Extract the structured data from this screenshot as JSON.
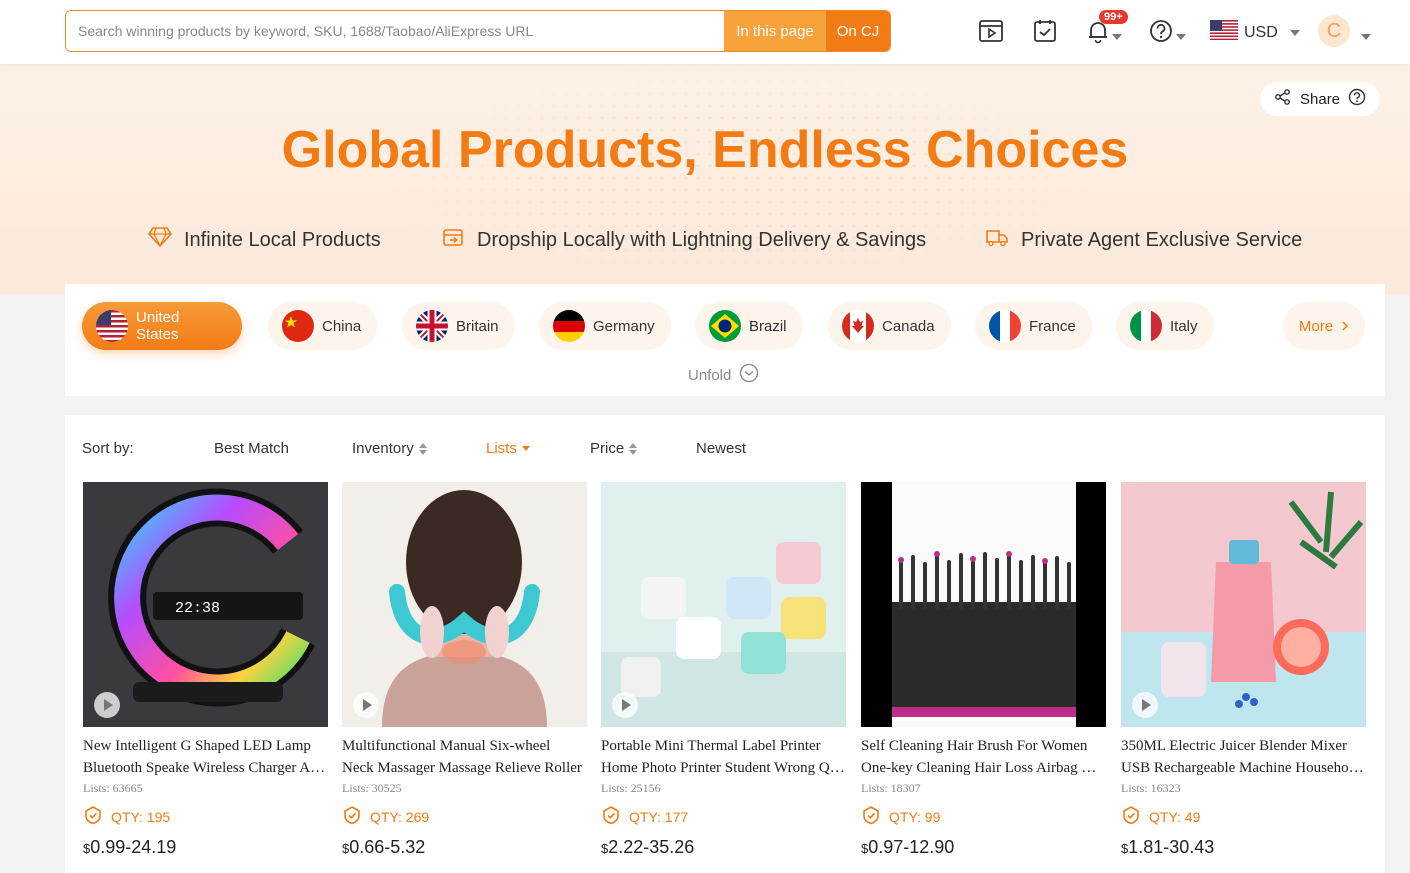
{
  "header": {
    "search_placeholder": "Search winning products by keyword, SKU, 1688/Taobao/AliExpress URL",
    "btn_this_page": "In this page",
    "btn_on_cj": "On CJ",
    "notification_badge": "99+",
    "currency": "USD",
    "avatar_letter": "C"
  },
  "hero": {
    "share_label": "Share",
    "title": "Global Products, Endless Choices",
    "features": [
      "Infinite Local Products",
      "Dropship Locally with Lightning Delivery & Savings",
      "Private Agent Exclusive Service"
    ]
  },
  "countries": {
    "items": [
      "United States",
      "China",
      "Britain",
      "Germany",
      "Brazil",
      "Canada",
      "France",
      "Italy"
    ],
    "more_label": "More",
    "unfold_label": "Unfold"
  },
  "sort": {
    "label": "Sort by:",
    "options": [
      "Best Match",
      "Inventory",
      "Lists",
      "Price",
      "Newest"
    ],
    "active": "Lists"
  },
  "products": [
    {
      "title1": "New Intelligent G Shaped LED Lamp",
      "title2": "Bluetooth Speake Wireless Charger Atmosphere Lamp",
      "lists": "Lists: 63665",
      "qty": "QTY: 195",
      "currency_symbol": "$",
      "price": "0.99-24.19"
    },
    {
      "title1": "Multifunctional Manual Six-wheel",
      "title2": "Neck Massager Massage Relieve Roller",
      "lists": "Lists: 30525",
      "qty": "QTY: 269",
      "currency_symbol": "$",
      "price": "0.66-5.32"
    },
    {
      "title1": "Portable Mini Thermal Label Printer",
      "title2": "Home Photo Printer Student Wrong Question",
      "lists": "Lists: 25156",
      "qty": "QTY: 177",
      "currency_symbol": "$",
      "price": "2.22-35.26"
    },
    {
      "title1": "Self Cleaning Hair Brush For Women",
      "title2": "One-key Cleaning Hair Loss Airbag Massage",
      "lists": "Lists: 18307",
      "qty": "QTY: 99",
      "currency_symbol": "$",
      "price": "0.97-12.90"
    },
    {
      "title1": "350ML Electric Juicer Blender Mixer",
      "title2": "USB Rechargeable Machine Household Portable",
      "lists": "Lists: 16323",
      "qty": "QTY: 49",
      "currency_symbol": "$",
      "price": "1.81-30.43"
    }
  ],
  "colors": {
    "accent": "#f37b14",
    "accent_light": "#f7a23b",
    "badge_red": "#e8382f"
  }
}
